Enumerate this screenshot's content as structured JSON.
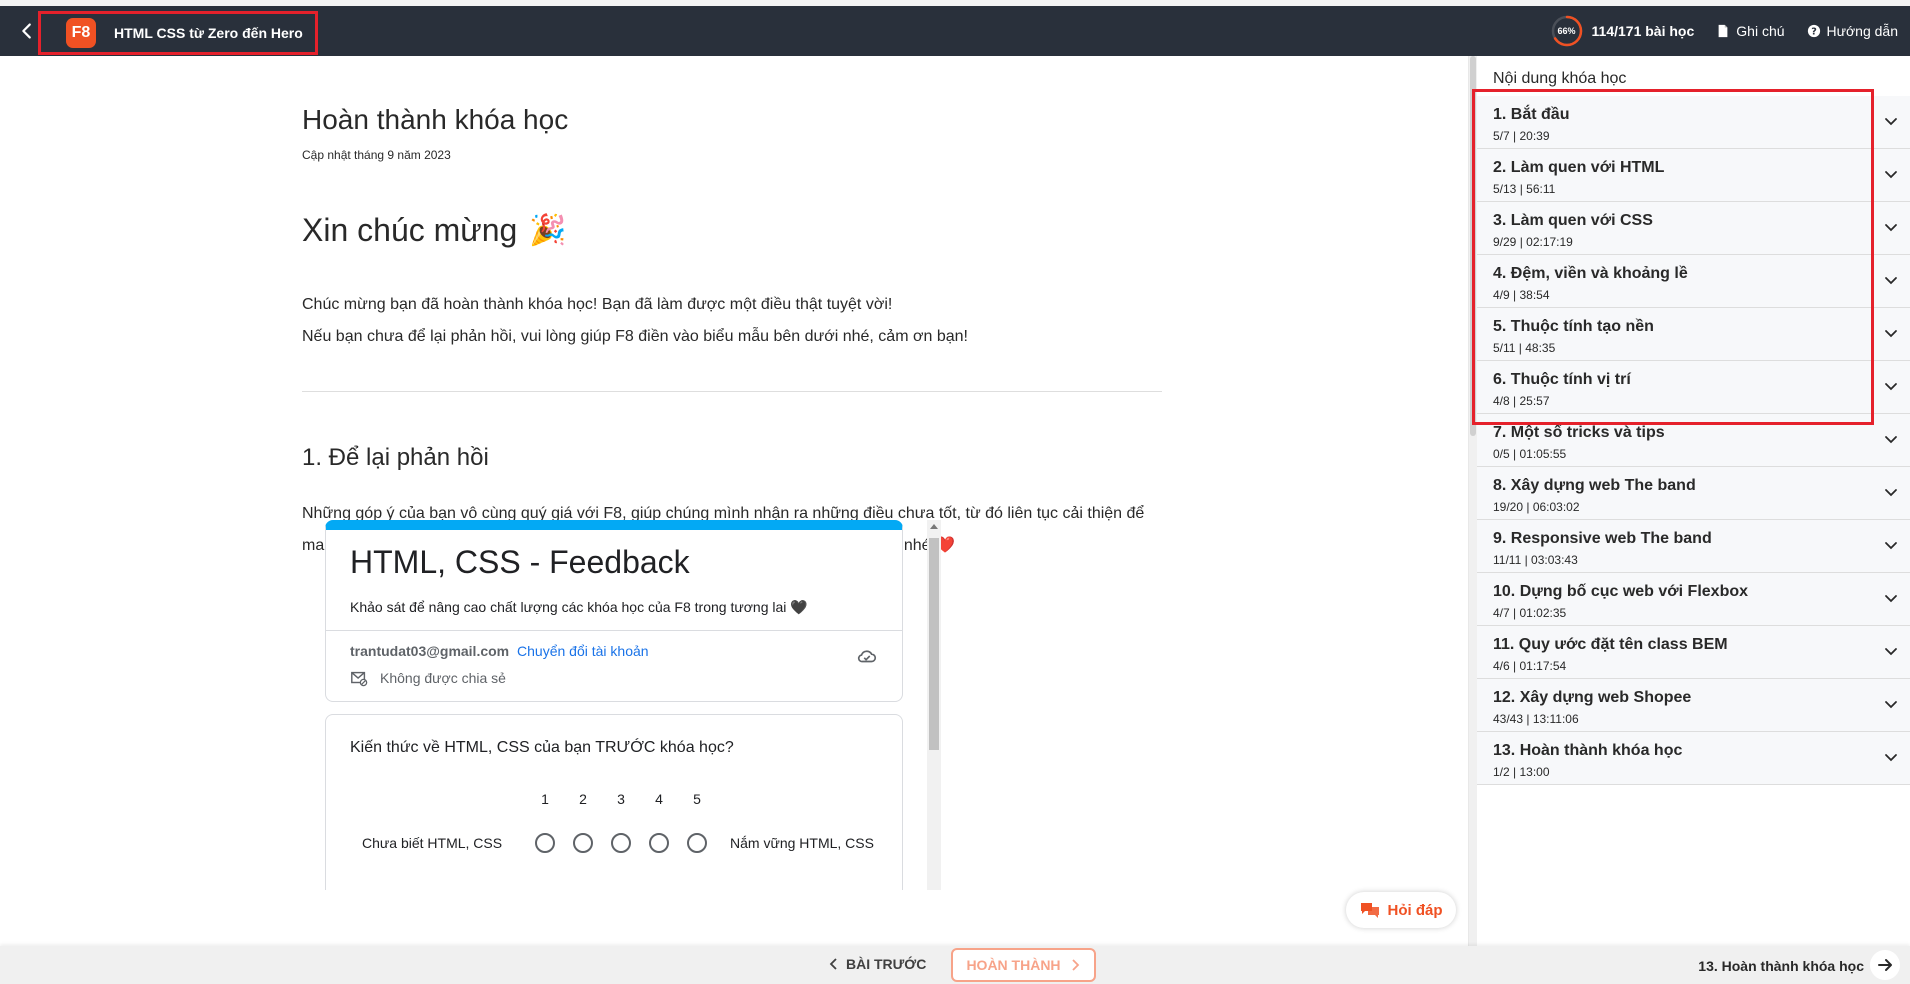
{
  "header": {
    "logo_text": "F8",
    "course_title": "HTML CSS từ Zero đến Hero",
    "progress_percent_label": "66%",
    "progress_fraction": 0.66,
    "lessons_count": "114/171 bài học",
    "notes_label": "Ghi chú",
    "guide_label": "Hướng dẫn"
  },
  "main": {
    "page_title": "Hoàn thành khóa học",
    "updated": "Cập nhật tháng 9 năm 2023",
    "congrats_title": "Xin chúc mừng",
    "congrats_emoji": "🎉",
    "paragraph1": "Chúc mừng bạn đã hoàn thành khóa học! Bạn đã làm được một điều thật tuyệt vời!",
    "paragraph2": "Nếu bạn chưa để lại phản hồi, vui lòng giúp F8 điền vào biểu mẫu bên dưới nhé, cảm ơn bạn!",
    "section_heading": "1. Để lại phản hồi",
    "feedback_paragraph": "Những góp ý của bạn vô cùng quý giá với F8, giúp chúng mình nhận ra những điều chưa tốt, từ đó liên tục cải thiện để mang lại sản phẩm chất lượng hơn cho cộng đồng. Để lại phản hồi giúp chúng mình nhé ❤️"
  },
  "form": {
    "title": "HTML, CSS - Feedback",
    "description": "Khảo sát để nâng cao chất lượng các khóa học của F8 trong tương lai 🖤",
    "account_email": "trantudat03@gmail.com",
    "switch_account": "Chuyển đổi tài khoản",
    "not_shared": "Không được chia sẻ",
    "question": "Kiến thức về HTML, CSS của bạn TRƯỚC khóa học?",
    "scale": [
      "1",
      "2",
      "3",
      "4",
      "5"
    ],
    "scale_low": "Chưa biết HTML, CSS",
    "scale_high": "Nắm vững HTML, CSS"
  },
  "qa_button": "Hỏi đáp",
  "sidebar": {
    "title": "Nội dung khóa học",
    "sections": [
      {
        "title": "1. Bắt đầu",
        "meta": "5/7 | 20:39"
      },
      {
        "title": "2. Làm quen với HTML",
        "meta": "5/13 | 56:11"
      },
      {
        "title": "3. Làm quen với CSS",
        "meta": "9/29 | 02:17:19"
      },
      {
        "title": "4. Đệm, viền và khoảng lề",
        "meta": "4/9 | 38:54"
      },
      {
        "title": "5. Thuộc tính tạo nền",
        "meta": "5/11 | 48:35"
      },
      {
        "title": "6. Thuộc tính vị trí",
        "meta": "4/8 | 25:57"
      },
      {
        "title": "7. Một số tricks và tips",
        "meta": "0/5 | 01:05:55"
      },
      {
        "title": "8. Xây dựng web The band",
        "meta": "19/20 | 06:03:02"
      },
      {
        "title": "9. Responsive web The band",
        "meta": "11/11 | 03:03:43"
      },
      {
        "title": "10. Dựng bố cục web với Flexbox",
        "meta": "4/7 | 01:02:35"
      },
      {
        "title": "11. Quy ước đặt tên class BEM",
        "meta": "4/6 | 01:17:54"
      },
      {
        "title": "12. Xây dựng web Shopee",
        "meta": "43/43 | 13:11:06"
      },
      {
        "title": "13. Hoàn thành khóa học",
        "meta": "1/2 | 13:00"
      }
    ]
  },
  "footer": {
    "prev_label": "BÀI TRƯỚC",
    "next_label": "HOÀN THÀNH",
    "current_section": "13. Hoàn thành khóa học"
  },
  "colors": {
    "header_bg": "#29303b",
    "brand_orange": "#f05123",
    "highlight_red": "#e5212b",
    "form_accent": "#03a9f4"
  }
}
